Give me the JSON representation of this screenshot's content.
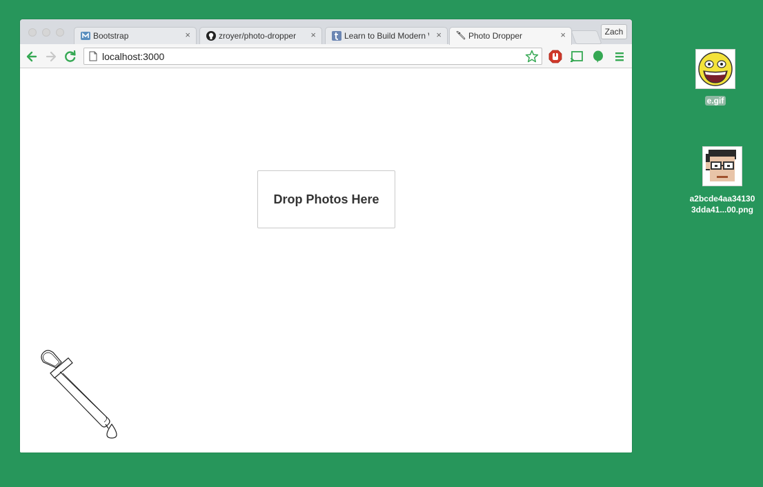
{
  "browser": {
    "tabs": [
      {
        "title": "Bootstrap",
        "icon": "bootstrap-favicon",
        "active": false
      },
      {
        "title": "zroyer/photo-dropper",
        "icon": "github-favicon",
        "active": false
      },
      {
        "title": "Learn to Build Modern W",
        "icon": "tumblr-favicon",
        "active": false
      },
      {
        "title": "Photo Dropper",
        "icon": "dropper-favicon",
        "active": true
      }
    ],
    "close_glyph": "×",
    "profile_label": "Zach",
    "url": "localhost:3000"
  },
  "page": {
    "dropzone_label": "Drop Photos Here"
  },
  "desktop": {
    "icons": [
      {
        "label": "e.gif",
        "thumbnail": "awesome-smiley-face"
      },
      {
        "label_line1": "a2bcde4aa34130",
        "label_line2": "3dda41...00.png",
        "thumbnail": "pixel-avatar-glasses"
      }
    ]
  },
  "colors": {
    "desktop_bg": "#27965b",
    "accent_green": "#35a853",
    "tab_active": "#f6f6f6",
    "tab_inactive": "#e7e9ec"
  }
}
